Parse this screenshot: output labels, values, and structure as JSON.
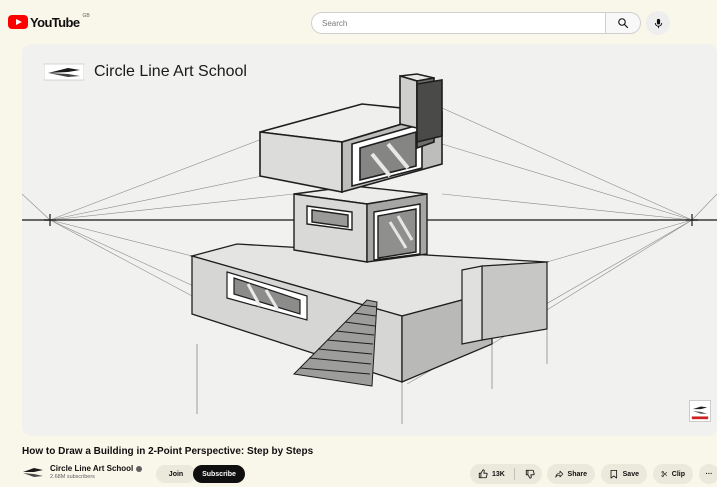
{
  "header": {
    "logo_text": "YouTube",
    "region_code": "GB",
    "search_placeholder": "Search",
    "icons": [
      "youtube-logo-icon",
      "search-icon",
      "microphone-icon"
    ]
  },
  "player": {
    "watermark_text": "Circle Line Art School",
    "icons": [
      "channel-pencil-logo-icon",
      "corner-logo-badge-icon"
    ]
  },
  "video": {
    "title": "How to Draw a Building in 2-Point Perspective: Step by Steps"
  },
  "channel": {
    "name": "Circle Line Art School",
    "subscribers": "2.68M subscribers",
    "join_label": "Join",
    "subscribe_label": "Subscribe"
  },
  "actions": {
    "likes": "13K",
    "share_label": "Share",
    "save_label": "Save",
    "clip_label": "Clip",
    "more_label": "···",
    "icons": [
      "thumbs-up-icon",
      "thumbs-down-icon",
      "share-arrow-icon",
      "save-playlist-icon",
      "scissors-icon",
      "more-icon"
    ]
  },
  "colors": {
    "page_background": "#f9f6ea",
    "brand_red": "#ff0000",
    "subscribe_background": "#0f0f0f",
    "chip_background": "#ebe8dc"
  }
}
